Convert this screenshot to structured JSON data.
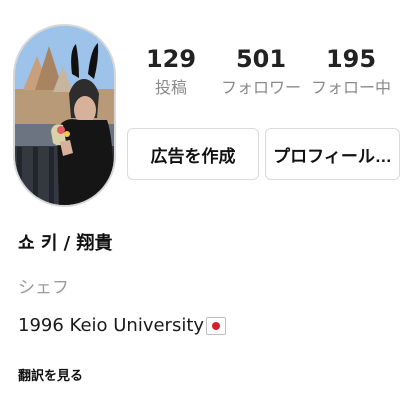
{
  "profile": {
    "avatar_icon": "profile-photo-avatar",
    "stats": [
      {
        "value": "129",
        "label": "投稿"
      },
      {
        "value": "501",
        "label": "フォロワー"
      },
      {
        "value": "195",
        "label": "フォロー中"
      }
    ],
    "buttons": {
      "create_ad": "広告を作成",
      "profile": "プロフィール…"
    },
    "name": "쇼 키 / 翔貴",
    "category": "シェフ",
    "bio": "1996 Keio University",
    "bio_flag": "japan-flag-icon",
    "translate": "翻訳を見る"
  },
  "colors": {
    "border": "#dbdbdb",
    "muted_text": "#8a8a8a",
    "flag_red": "#d51e2f"
  }
}
